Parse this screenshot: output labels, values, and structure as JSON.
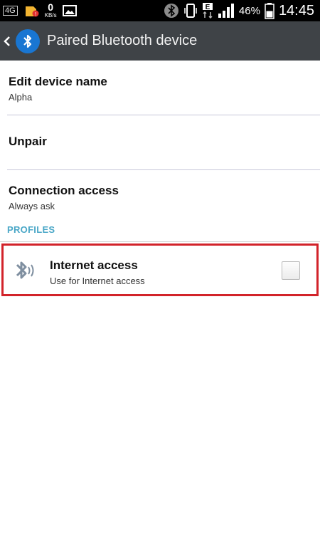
{
  "status_bar": {
    "network_badge": "4G",
    "speed_value": "0",
    "speed_unit": "KB/s",
    "battery_percent": "46%",
    "time": "14:45",
    "data_indicator": "E",
    "icons": [
      "sd-card-notification-icon",
      "image-icon",
      "bluetooth-status-icon",
      "vibrate-icon",
      "data-arrows-icon",
      "signal-icon",
      "battery-icon"
    ]
  },
  "action_bar": {
    "title": "Paired Bluetooth device",
    "icon": "bluetooth-icon"
  },
  "settings": {
    "items": [
      {
        "title": "Edit device name",
        "subtitle": "Alpha"
      },
      {
        "title": "Unpair"
      },
      {
        "title": "Connection access",
        "subtitle": "Always ask"
      }
    ]
  },
  "profiles": {
    "header": "PROFILES",
    "items": [
      {
        "title": "Internet access",
        "subtitle": "Use for Internet access",
        "checked": false
      }
    ]
  },
  "colors": {
    "actionbar_bg": "#3f4347",
    "accent_header": "#4aa7c7",
    "highlight_border": "#d2232a",
    "bluetooth_blue": "#1976d2"
  }
}
